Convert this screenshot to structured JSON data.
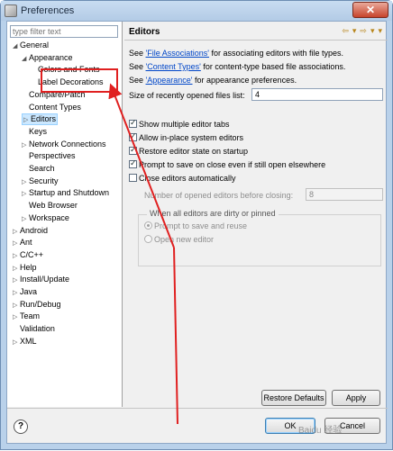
{
  "window": {
    "title": "Preferences",
    "close": "✕"
  },
  "filter": {
    "placeholder": "type filter text"
  },
  "tree": [
    {
      "label": "General",
      "arrow": "◢"
    },
    {
      "label": "Appearance",
      "arrow": "◢"
    },
    {
      "label": "Colors and Fonts",
      "arrow": ""
    },
    {
      "label": "Label Decorations",
      "arrow": ""
    },
    {
      "label": "Compare/Patch",
      "arrow": ""
    },
    {
      "label": "Content Types",
      "arrow": ""
    },
    {
      "label": "Editors",
      "arrow": "▷"
    },
    {
      "label": "Keys",
      "arrow": ""
    },
    {
      "label": "Network Connections",
      "arrow": "▷"
    },
    {
      "label": "Perspectives",
      "arrow": ""
    },
    {
      "label": "Search",
      "arrow": ""
    },
    {
      "label": "Security",
      "arrow": "▷"
    },
    {
      "label": "Startup and Shutdown",
      "arrow": "▷"
    },
    {
      "label": "Web Browser",
      "arrow": ""
    },
    {
      "label": "Workspace",
      "arrow": "▷"
    },
    {
      "label": "Android",
      "arrow": "▷"
    },
    {
      "label": "Ant",
      "arrow": "▷"
    },
    {
      "label": "C/C++",
      "arrow": "▷"
    },
    {
      "label": "Help",
      "arrow": "▷"
    },
    {
      "label": "Install/Update",
      "arrow": "▷"
    },
    {
      "label": "Java",
      "arrow": "▷"
    },
    {
      "label": "Run/Debug",
      "arrow": "▷"
    },
    {
      "label": "Team",
      "arrow": "▷"
    },
    {
      "label": "Validation",
      "arrow": ""
    },
    {
      "label": "XML",
      "arrow": "▷"
    }
  ],
  "page": {
    "title": "Editors",
    "nav": [
      "⇦",
      "▾",
      "⇨",
      "▾",
      "▾"
    ],
    "see1_pre": "See ",
    "see1_link": "'File Associations'",
    "see1_post": " for associating editors with file types.",
    "see2_pre": "See ",
    "see2_link": "'Content Types'",
    "see2_post": " for content-type based file associations.",
    "see3_pre": "See ",
    "see3_link": "'Appearance'",
    "see3_post": " for appearance preferences.",
    "recent_label": "Size of recently opened files list:",
    "recent_value": "4",
    "cb_multiple": "Show multiple editor tabs",
    "cb_inplace": "Allow in-place system editors",
    "cb_restore": "Restore editor state on startup",
    "cb_prompt": "Prompt to save on close even if still open elsewhere",
    "cb_close": "Close editors automatically",
    "opened_label": "Number of opened editors before closing:",
    "opened_value": "8",
    "group_label": "When all editors are dirty or pinned",
    "radio_prompt": "Prompt to save and reuse",
    "radio_open": "Open new editor",
    "restore_defaults": "Restore Defaults",
    "apply": "Apply"
  },
  "footer": {
    "help": "?",
    "ok": "OK",
    "cancel": "Cancel"
  },
  "watermark": "Baidu 经验"
}
